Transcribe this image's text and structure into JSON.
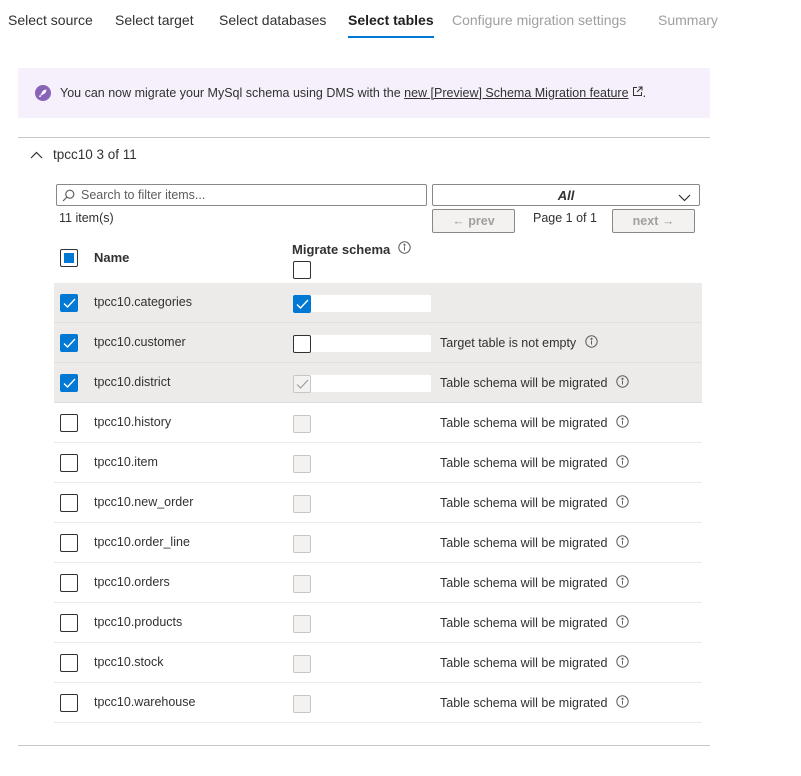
{
  "tabs": [
    {
      "label": "Select source",
      "state": "normal"
    },
    {
      "label": "Select target",
      "state": "normal"
    },
    {
      "label": "Select databases",
      "state": "normal"
    },
    {
      "label": "Select tables",
      "state": "active"
    },
    {
      "label": "Configure migration settings",
      "state": "disabled"
    },
    {
      "label": "Summary",
      "state": "disabled"
    }
  ],
  "banner": {
    "text": "You can now migrate your MySql schema using DMS with the ",
    "link": "new [Preview] Schema Migration feature",
    "suffix": "."
  },
  "group": {
    "title": "tpcc10 3 of 11"
  },
  "filter": {
    "search_placeholder": "Search to filter items...",
    "dropdown_value": "All",
    "count_text": "11 item(s)",
    "prev_label": "← prev",
    "page_label": "Page 1 of 1",
    "next_label": "next →"
  },
  "table": {
    "col_name": "Name",
    "col_migrate": "Migrate schema",
    "rows": [
      {
        "name": "tpcc10.categories",
        "selected": true,
        "schema": "checked",
        "note": ""
      },
      {
        "name": "tpcc10.customer",
        "selected": true,
        "schema": "unchecked",
        "note": "Target table is not empty"
      },
      {
        "name": "tpcc10.district",
        "selected": true,
        "schema": "disabled-checked",
        "note": "Table schema will be migrated"
      },
      {
        "name": "tpcc10.history",
        "selected": false,
        "schema": "disabled",
        "note": "Table schema will be migrated"
      },
      {
        "name": "tpcc10.item",
        "selected": false,
        "schema": "disabled",
        "note": "Table schema will be migrated"
      },
      {
        "name": "tpcc10.new_order",
        "selected": false,
        "schema": "disabled",
        "note": "Table schema will be migrated"
      },
      {
        "name": "tpcc10.order_line",
        "selected": false,
        "schema": "disabled",
        "note": "Table schema will be migrated"
      },
      {
        "name": "tpcc10.orders",
        "selected": false,
        "schema": "disabled",
        "note": "Table schema will be migrated"
      },
      {
        "name": "tpcc10.products",
        "selected": false,
        "schema": "disabled",
        "note": "Table schema will be migrated"
      },
      {
        "name": "tpcc10.stock",
        "selected": false,
        "schema": "disabled",
        "note": "Table schema will be migrated"
      },
      {
        "name": "tpcc10.warehouse",
        "selected": false,
        "schema": "disabled",
        "note": "Table schema will be migrated"
      }
    ]
  },
  "colors": {
    "accent": "#0078d4",
    "selected_row": "#edebe9",
    "banner_bg": "#f5f0fb",
    "banner_icon": "#8764b8"
  },
  "icons": [
    "rocket-icon",
    "external-link-icon",
    "chevron-up-icon",
    "search-icon",
    "chevron-down-icon",
    "info-icon",
    "checkmark-icon"
  ]
}
